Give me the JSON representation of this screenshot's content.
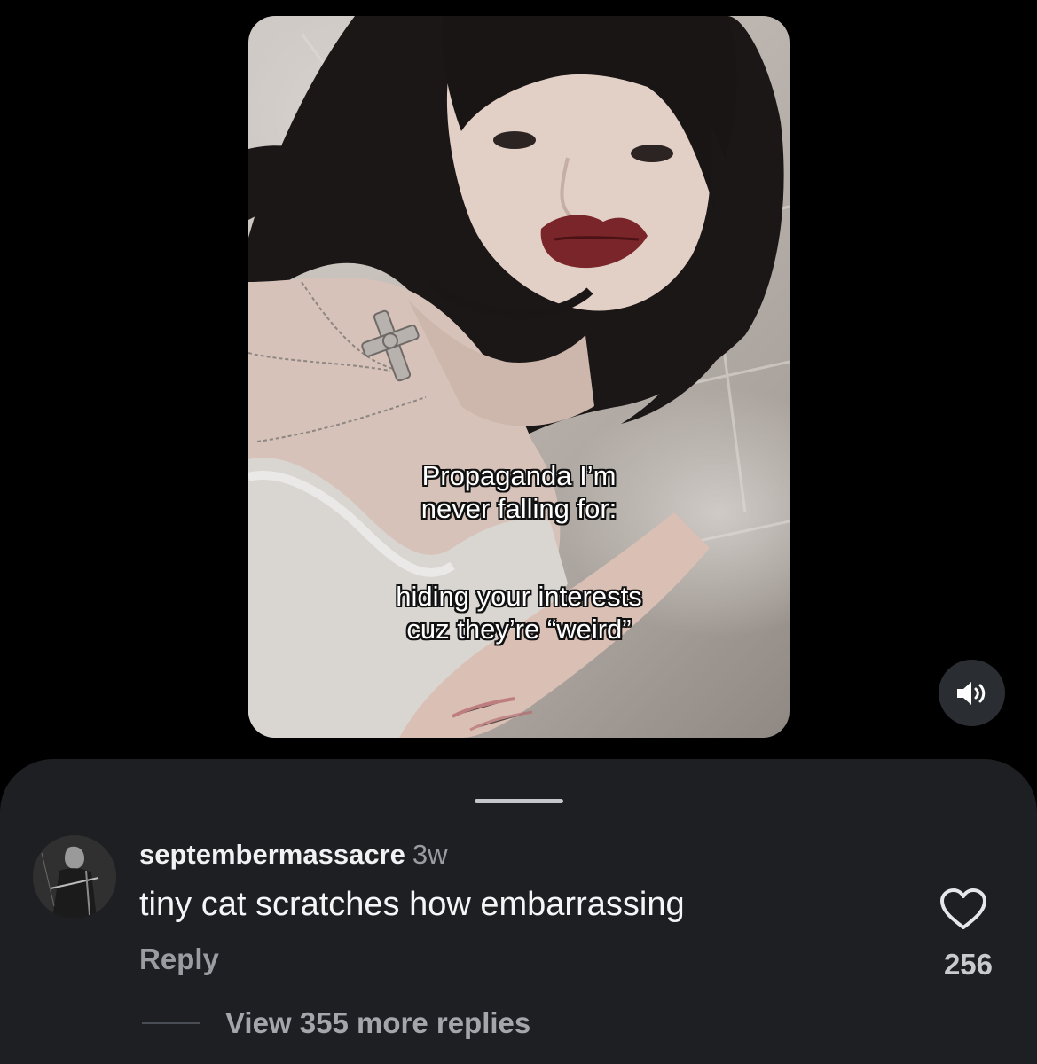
{
  "video": {
    "overlay_lines_1": [
      "Propaganda I’m",
      "never falling for:"
    ],
    "overlay_lines_2": [
      "hiding your interests",
      "cuz they’re “weird”"
    ],
    "sound_icon": "speaker-on-icon"
  },
  "comment": {
    "username": "septembermassacre",
    "timestamp": "3w",
    "text": "tiny cat scratches how embarrassing",
    "reply_label": "Reply",
    "like_count": "256",
    "like_icon": "heart-outline-icon",
    "view_replies_label": "View 355 more replies"
  },
  "colors": {
    "background": "#000000",
    "sheet": "#1d1f23",
    "primary_text": "#f5f5f7",
    "secondary_text": "#9a9ca2"
  }
}
